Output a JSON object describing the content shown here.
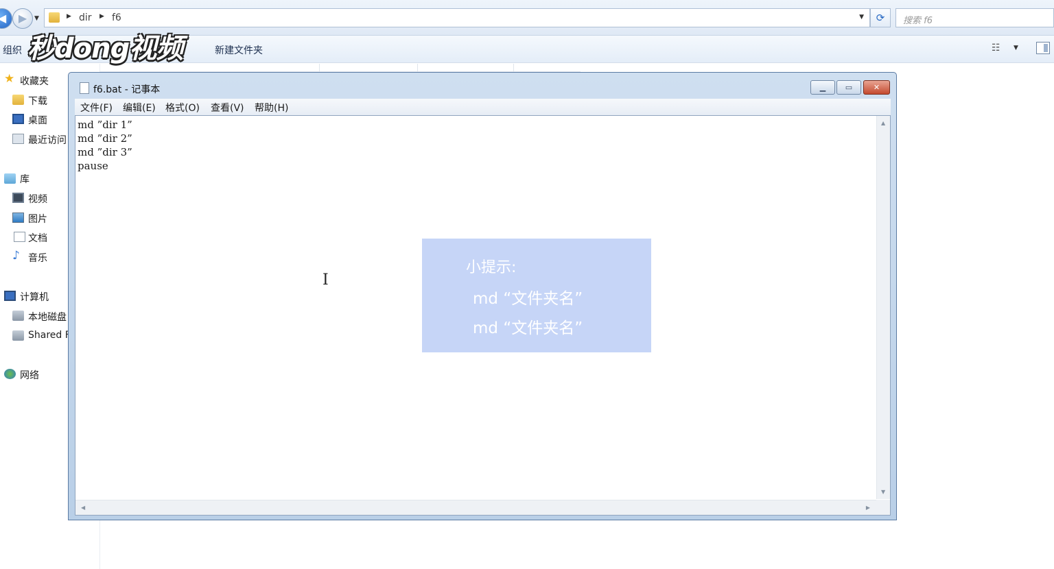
{
  "explorer": {
    "breadcrumb": [
      "dir",
      "f6"
    ],
    "search_placeholder": "搜索 f6",
    "toolbar": {
      "organize_label": "组织",
      "new_folder_label": "新建文件夹"
    },
    "nav_pane": {
      "favorites": {
        "label": "收藏夹",
        "items": [
          "下载",
          "桌面",
          "最近访问"
        ]
      },
      "libraries": {
        "label": "库",
        "items": [
          "视频",
          "图片",
          "文档",
          "音乐"
        ]
      },
      "computer": {
        "label": "计算机",
        "items": [
          "本地磁盘",
          "Shared F"
        ]
      },
      "network": {
        "label": "网络"
      }
    }
  },
  "watermark": {
    "text": "秒dong视频"
  },
  "notepad": {
    "title": "f6.bat - 记事本",
    "menu": [
      "文件(F)",
      "编辑(E)",
      "格式(O)",
      "查看(V)",
      "帮助(H)"
    ],
    "lines": [
      "md ”dir 1”",
      "md ”dir 2”",
      "md ”dir 3”",
      "pause"
    ]
  },
  "tip": {
    "title": "小提示:",
    "lines": [
      "md  “文件夹名”",
      "md  “文件夹名”"
    ]
  },
  "colors": {
    "tip_background": "#c6d5f7",
    "close_button": "#c44a2f",
    "window_frame": "#b9cfe7"
  }
}
